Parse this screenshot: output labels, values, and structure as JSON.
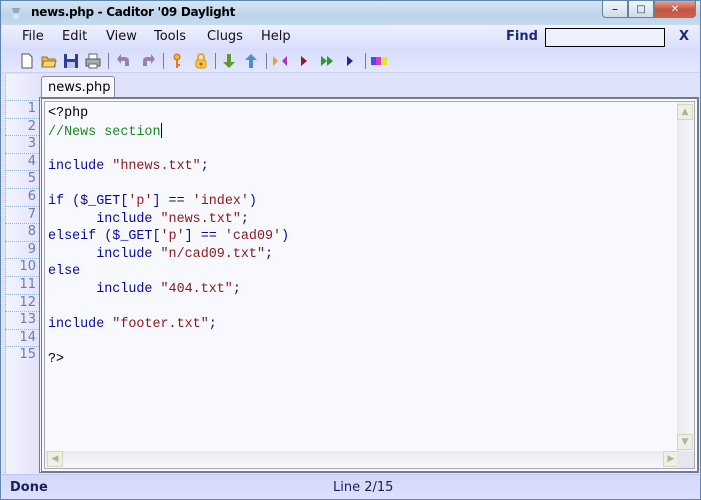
{
  "window": {
    "title": "news.php - Caditor '09 Daylight",
    "icon": "lamp-icon",
    "controls": [
      "minimize",
      "maximize",
      "close"
    ]
  },
  "menubar": {
    "items": [
      {
        "label": "File"
      },
      {
        "label": "Edit"
      },
      {
        "label": "View"
      },
      {
        "label": "Tools"
      },
      {
        "label": "Clugs"
      },
      {
        "label": "Help"
      }
    ],
    "find_label": "Find",
    "find_value": "",
    "find_close": "X"
  },
  "toolbar": {
    "buttons": [
      {
        "name": "new-file",
        "icon": "new-document-icon"
      },
      {
        "name": "open-file",
        "icon": "open-folder-icon"
      },
      {
        "name": "save",
        "icon": "floppy-icon"
      },
      {
        "name": "print",
        "icon": "printer-icon"
      },
      {
        "name": "undo",
        "icon": "undo-icon"
      },
      {
        "name": "redo",
        "icon": "redo-icon"
      },
      {
        "name": "key",
        "icon": "key-icon"
      },
      {
        "name": "lock",
        "icon": "lock-icon"
      },
      {
        "name": "down",
        "icon": "arrow-down-icon"
      },
      {
        "name": "up",
        "icon": "arrow-up-icon"
      },
      {
        "name": "run-start",
        "icon": "run-start-icon"
      },
      {
        "name": "run",
        "icon": "play-icon"
      },
      {
        "name": "fast-forward",
        "icon": "fast-forward-icon"
      },
      {
        "name": "step",
        "icon": "step-icon"
      },
      {
        "name": "spellcheck",
        "icon": "abc-spellcheck-icon"
      }
    ]
  },
  "tabs": [
    {
      "label": "news.php",
      "active": true
    }
  ],
  "editor": {
    "lines": [
      {
        "n": "1",
        "tokens": [
          {
            "t": "<?php",
            "c": "pl"
          }
        ]
      },
      {
        "n": "2",
        "tokens": [
          {
            "t": "//News section",
            "c": "cm"
          }
        ],
        "caret": true
      },
      {
        "n": "3",
        "tokens": []
      },
      {
        "n": "4",
        "tokens": [
          {
            "t": "include",
            "c": "kw"
          },
          {
            "t": " ",
            "c": "pl"
          },
          {
            "t": "\"hnews.txt\"",
            "c": "str"
          },
          {
            "t": ";",
            "c": "kw"
          }
        ]
      },
      {
        "n": "5",
        "tokens": []
      },
      {
        "n": "6",
        "tokens": [
          {
            "t": "if",
            "c": "kw"
          },
          {
            "t": " ($_GET[",
            "c": "kw"
          },
          {
            "t": "'p'",
            "c": "str"
          },
          {
            "t": "] == ",
            "c": "kw"
          },
          {
            "t": "'index'",
            "c": "str"
          },
          {
            "t": ")",
            "c": "kw"
          }
        ]
      },
      {
        "n": "7",
        "tokens": [
          {
            "t": "      include",
            "c": "kw"
          },
          {
            "t": " ",
            "c": "pl"
          },
          {
            "t": "\"news.txt\"",
            "c": "str"
          },
          {
            "t": ";",
            "c": "kw"
          }
        ]
      },
      {
        "n": "8",
        "tokens": [
          {
            "t": "elseif",
            "c": "kw"
          },
          {
            "t": " ($_GET[",
            "c": "kw"
          },
          {
            "t": "'p'",
            "c": "str"
          },
          {
            "t": "] == ",
            "c": "kw"
          },
          {
            "t": "'cad09'",
            "c": "str"
          },
          {
            "t": ")",
            "c": "kw"
          }
        ]
      },
      {
        "n": "9",
        "tokens": [
          {
            "t": "      include",
            "c": "kw"
          },
          {
            "t": " ",
            "c": "pl"
          },
          {
            "t": "\"n/cad09.txt\"",
            "c": "str"
          },
          {
            "t": ";",
            "c": "kw"
          }
        ]
      },
      {
        "n": "10",
        "tokens": [
          {
            "t": "else",
            "c": "kw"
          }
        ]
      },
      {
        "n": "11",
        "tokens": [
          {
            "t": "      include",
            "c": "kw"
          },
          {
            "t": " ",
            "c": "pl"
          },
          {
            "t": "\"404.txt\"",
            "c": "str"
          },
          {
            "t": ";",
            "c": "kw"
          }
        ]
      },
      {
        "n": "12",
        "tokens": []
      },
      {
        "n": "13",
        "tokens": [
          {
            "t": "include",
            "c": "kw"
          },
          {
            "t": " ",
            "c": "pl"
          },
          {
            "t": "\"footer.txt\"",
            "c": "str"
          },
          {
            "t": ";",
            "c": "kw"
          }
        ]
      },
      {
        "n": "14",
        "tokens": []
      },
      {
        "n": "15",
        "tokens": [
          {
            "t": "?>",
            "c": "pl"
          }
        ]
      }
    ]
  },
  "status": {
    "left": "Done",
    "position": "Line 2/15"
  },
  "colors": {
    "keyword": "#0a0aa0",
    "string": "#8b1a1a",
    "comment": "#1d8a22",
    "accent": "#1a2a7a"
  }
}
